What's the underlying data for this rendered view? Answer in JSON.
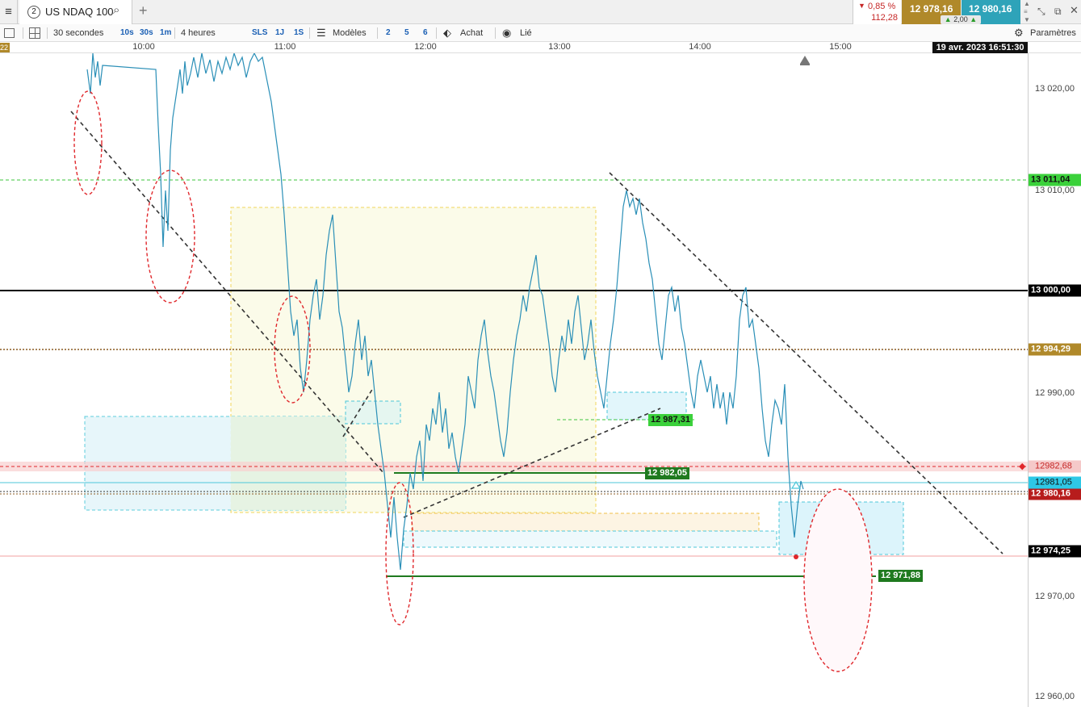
{
  "tabbar": {
    "tab_number": "2",
    "tab_title": "US NDAQ 100",
    "change_pct": "0,85 %",
    "change_abs": "112,28",
    "bid": "12 978,16",
    "ask": "12 980,16",
    "spread": "2,00"
  },
  "toolbar": {
    "interval": "30 secondes",
    "quick_intervals": [
      "10s",
      "30s",
      "1m"
    ],
    "range": "4 heures",
    "quick_ranges": [
      "SLS",
      "1J",
      "1S"
    ],
    "models": "Modèles",
    "nums": [
      "2",
      "5",
      "6"
    ],
    "buy": "Achat",
    "linked": "Lié",
    "settings": "Paramètres"
  },
  "timeaxis": {
    "left_stub": "22",
    "labels": [
      "10:00",
      "11:00",
      "12:00",
      "13:00",
      "14:00",
      "15:00"
    ],
    "cursor_date": "19 avr. 2023 16:51:30"
  },
  "priceaxis": {
    "labels": [
      "13 020,00",
      "13 010,00",
      "12 990,00",
      "12 970,00",
      "12 960,00"
    ],
    "tags": {
      "green_dashed": "13 011,04",
      "round": "13 000,00",
      "brown": "12 994,29",
      "red_dashed": "12982,68",
      "cyan": "12981,05",
      "current": "12 980,16",
      "low": "12 974,25"
    }
  },
  "chart_tags": {
    "level1": "12 987,31",
    "level2": "12 982,05",
    "level3": "12 971,88"
  },
  "colors": {
    "candle": "#2a8fb7",
    "bid_bg": "#b0892a",
    "ask_bg": "#2ea3b9",
    "green": "#1f7a1f",
    "red": "#e0282c"
  }
}
